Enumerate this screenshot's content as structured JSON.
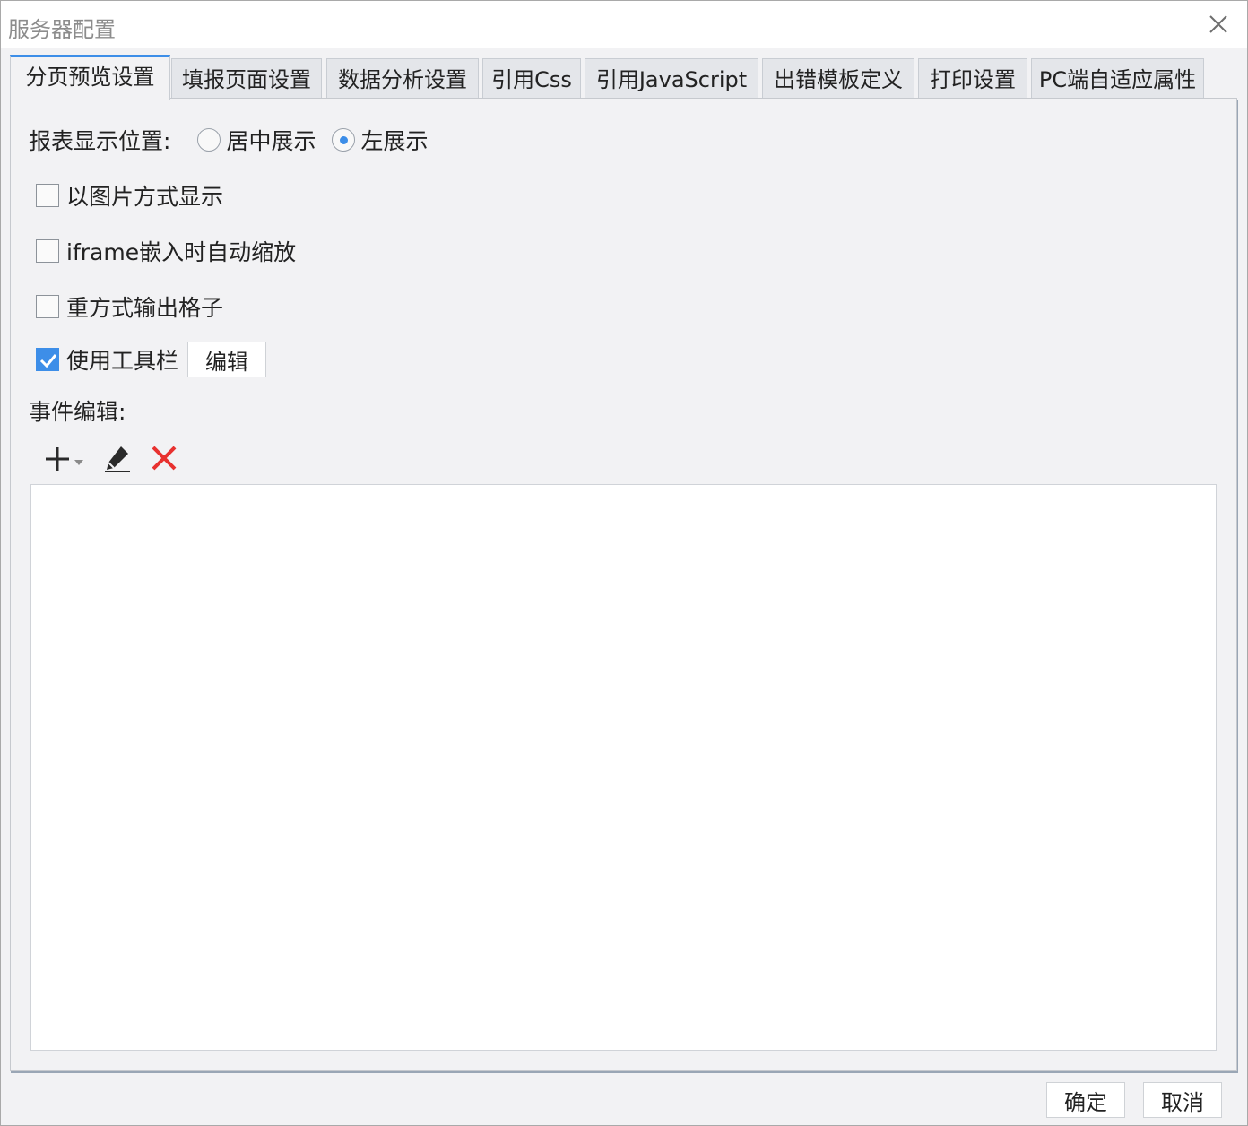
{
  "window": {
    "title": "服务器配置"
  },
  "tabs": [
    {
      "label": "分页预览设置",
      "active": true
    },
    {
      "label": "填报页面设置",
      "active": false
    },
    {
      "label": "数据分析设置",
      "active": false
    },
    {
      "label": "引用Css",
      "active": false
    },
    {
      "label": "引用JavaScript",
      "active": false
    },
    {
      "label": "出错模板定义",
      "active": false
    },
    {
      "label": "打印设置",
      "active": false
    },
    {
      "label": "PC端自适应属性",
      "active": false
    }
  ],
  "display_position": {
    "label": "报表显示位置:",
    "options": [
      {
        "label": "居中展示",
        "selected": false
      },
      {
        "label": "左展示",
        "selected": true
      }
    ]
  },
  "checkboxes": [
    {
      "label": "以图片方式显示",
      "checked": false
    },
    {
      "label": "iframe嵌入时自动缩放",
      "checked": false
    },
    {
      "label": "重方式输出格子",
      "checked": false
    },
    {
      "label": "使用工具栏",
      "checked": true
    }
  ],
  "toolbar_edit_button": "编辑",
  "event_editor": {
    "label": "事件编辑:",
    "icons": [
      "add-icon",
      "dropdown-arrow-icon",
      "edit-pencil-icon",
      "delete-icon"
    ],
    "items": []
  },
  "footer": {
    "ok_label": "确定",
    "cancel_label": "取消"
  },
  "colors": {
    "accent": "#3d8ee8",
    "delete": "#e8312f",
    "title_text": "#8c8c8c"
  }
}
